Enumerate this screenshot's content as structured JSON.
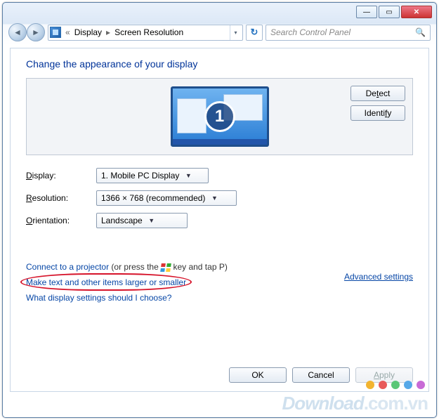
{
  "titlebar": {
    "min_glyph": "—",
    "max_glyph": "▭",
    "close_glyph": "✕"
  },
  "nav": {
    "back_glyph": "◄",
    "fwd_glyph": "►",
    "history_sep": "«",
    "crumb1": "Display",
    "crumb_sep": "▸",
    "crumb2": "Screen Resolution",
    "dropdown_glyph": "▾",
    "refresh_glyph": "↻",
    "search_placeholder": "Search Control Panel",
    "search_icon_glyph": "🔍"
  },
  "page": {
    "title": "Change the appearance of your display",
    "monitor_number": "1",
    "detect_label": "Detect",
    "identify_label": "Identify"
  },
  "form": {
    "display_label_pre": "",
    "display_label_u": "D",
    "display_label_post": "isplay:",
    "display_value": "1. Mobile PC Display",
    "resolution_label_u": "R",
    "resolution_label_post": "esolution:",
    "resolution_value": "1366 × 768 (recommended)",
    "orientation_label_u": "O",
    "orientation_label_post": "rientation:",
    "orientation_value": "Landscape",
    "combo_arrow": "▼"
  },
  "links": {
    "advanced": "Advanced settings",
    "projector_link": "Connect to a projector",
    "projector_hint_pre": " (or press the ",
    "projector_hint_post": " key and tap P)",
    "textsize": "Make text and other items larger or smaller",
    "which": "What display settings should I choose?"
  },
  "buttons": {
    "ok": "OK",
    "cancel": "Cancel",
    "apply_u": "A",
    "apply_post": "pply"
  },
  "watermark": {
    "text1": "Download",
    "text2": ".com.vn"
  },
  "dot_colors": [
    "#f2b430",
    "#e85a5a",
    "#5ac777",
    "#55a8e8",
    "#c86bd6"
  ]
}
